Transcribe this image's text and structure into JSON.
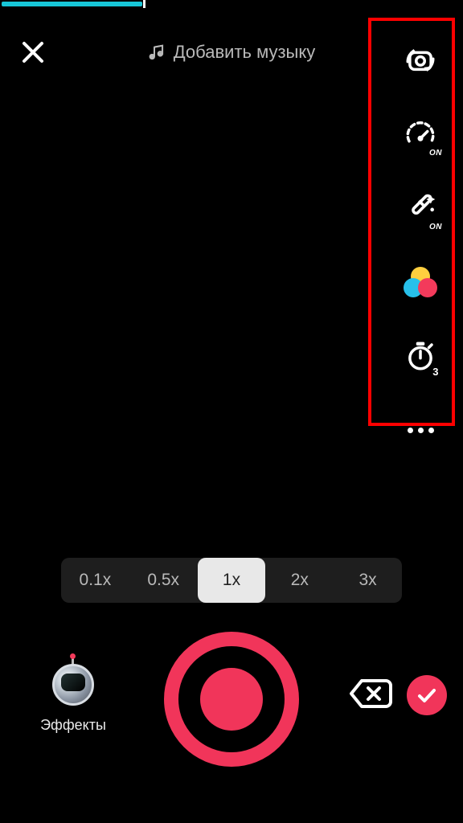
{
  "progress": {
    "percent": 30
  },
  "header": {
    "add_music_label": "Добавить музыку"
  },
  "side_tools": {
    "flip": "flip-camera",
    "speed_badge": "ON",
    "beauty_badge": "ON",
    "timer_badge": "3"
  },
  "speed": {
    "options": [
      "0.1x",
      "0.5x",
      "1x",
      "2x",
      "3x"
    ],
    "active_index": 2
  },
  "effects": {
    "label": "Эффекты"
  },
  "colors": {
    "accent": "#f1355a",
    "progress": "#17c6d8",
    "highlight": "#ff0000"
  }
}
